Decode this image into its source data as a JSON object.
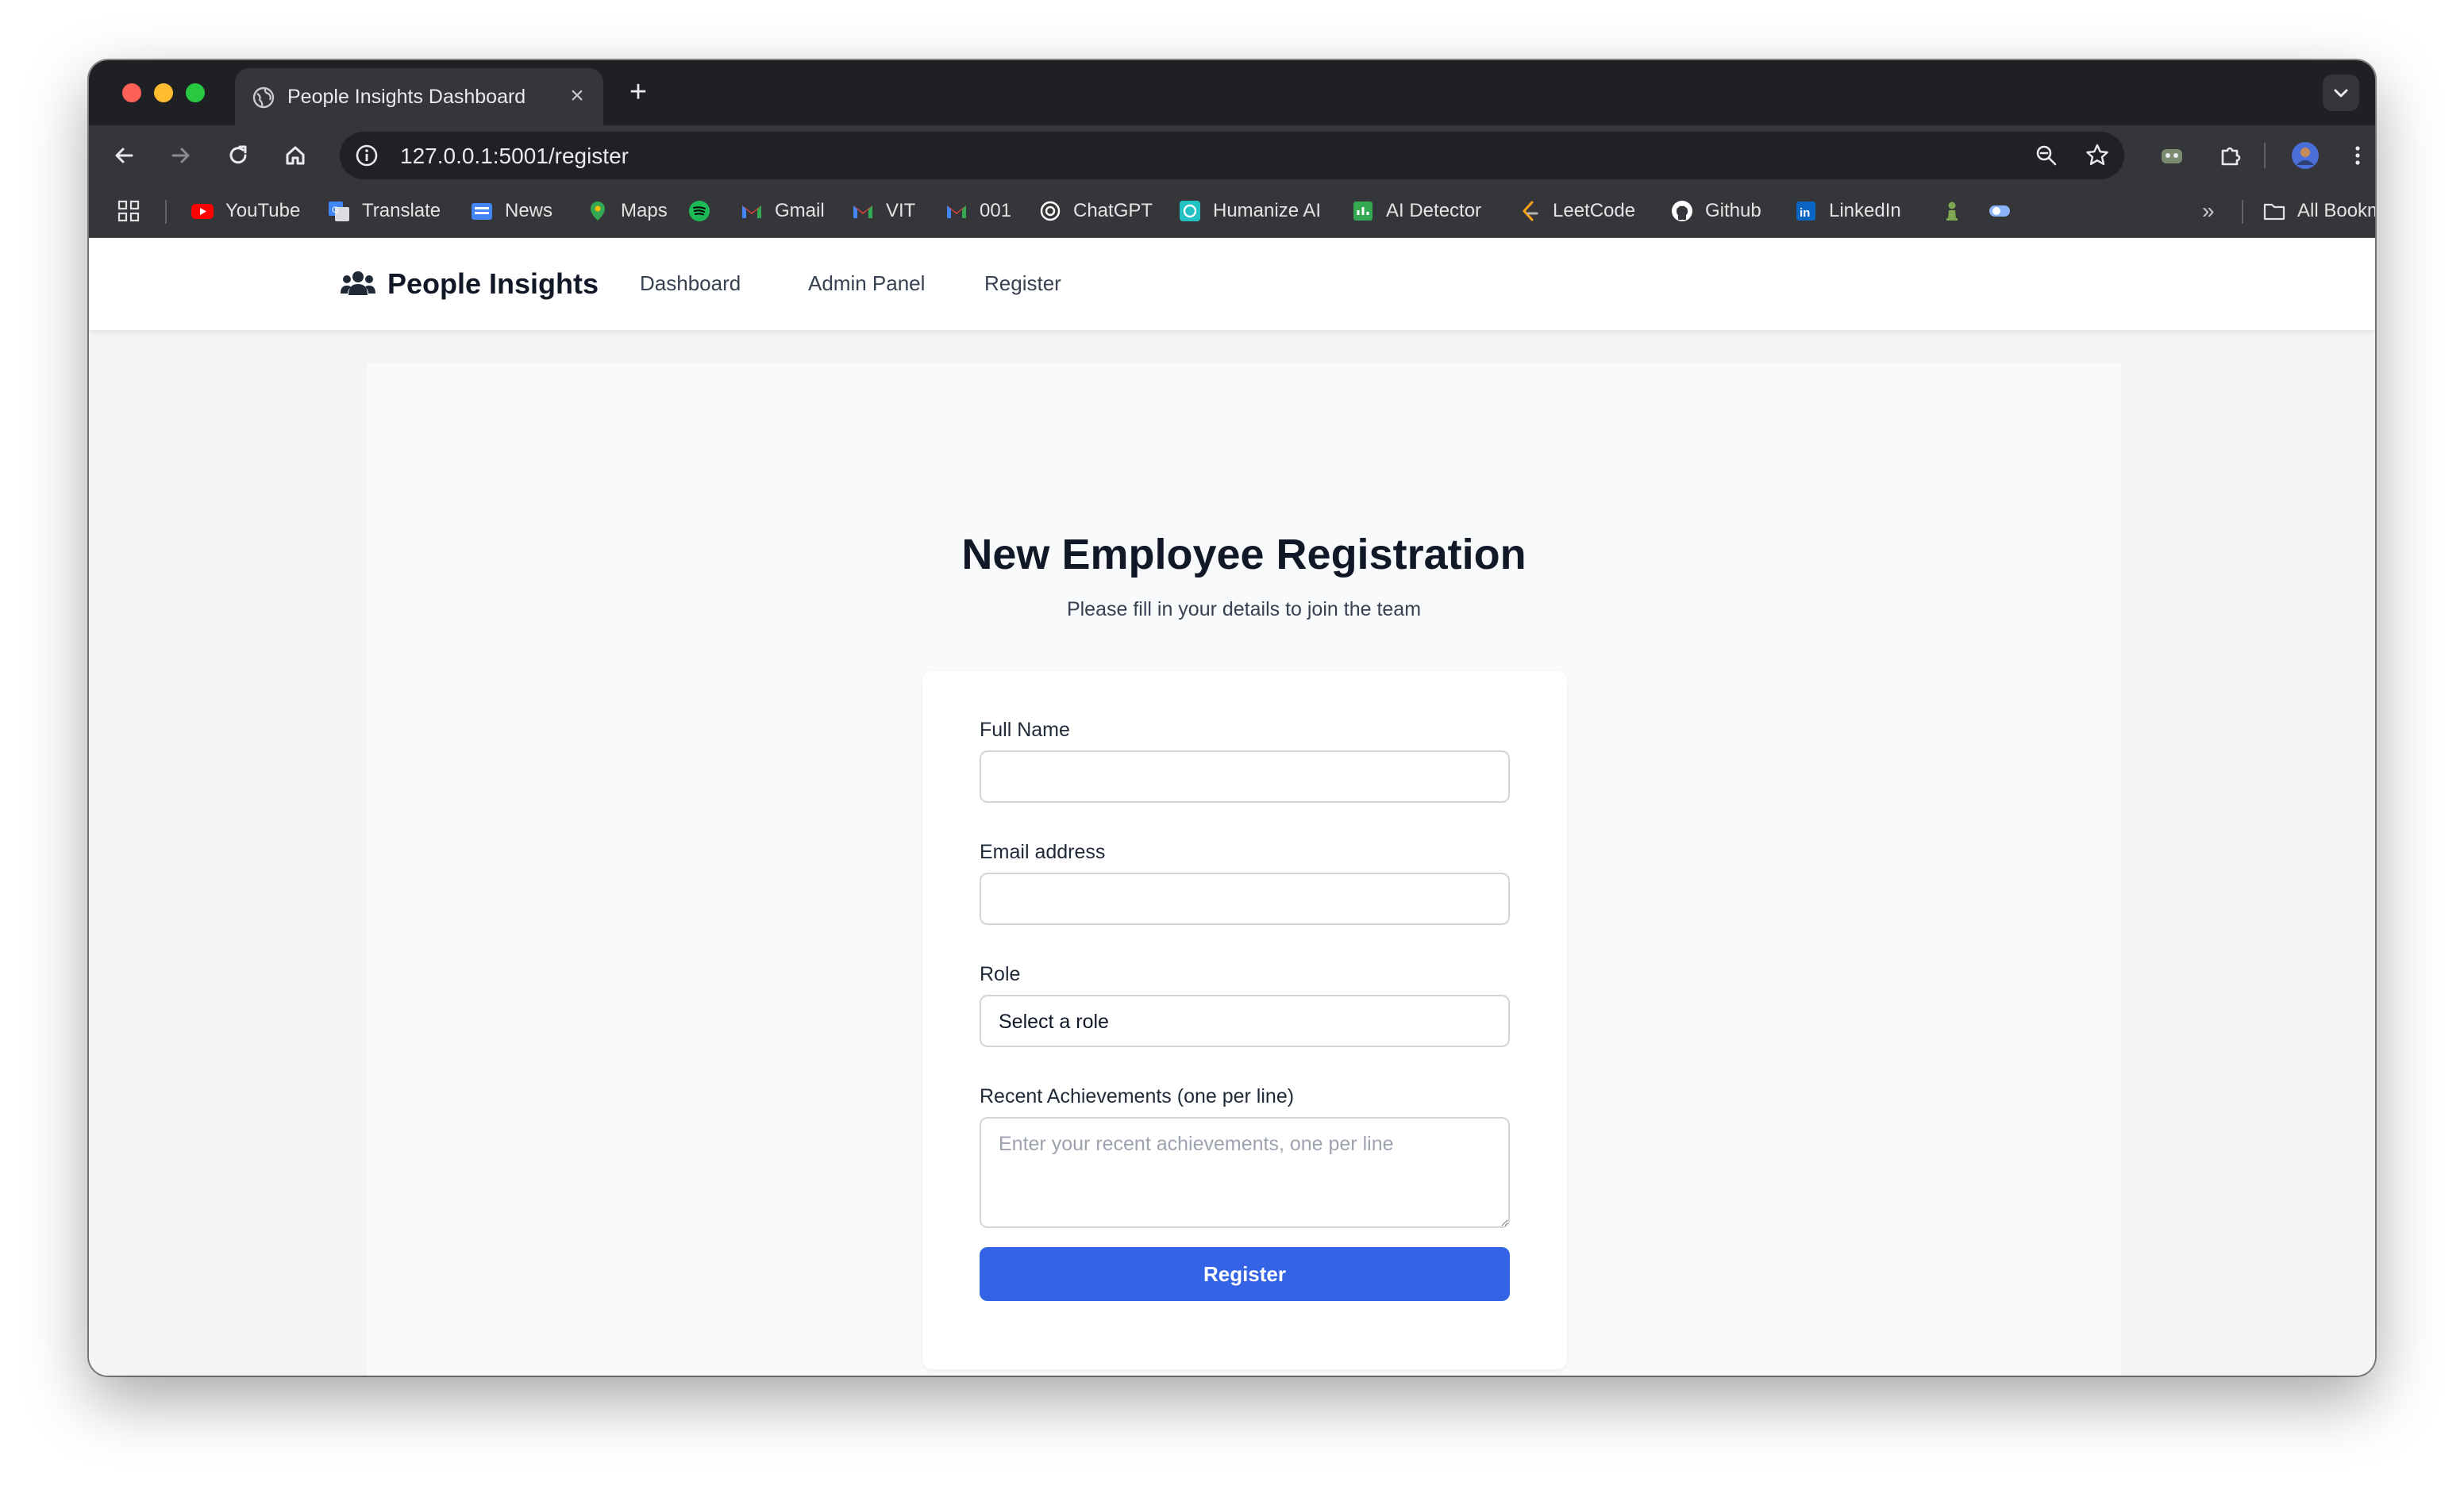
{
  "browser": {
    "tab_title": "People Insights Dashboard",
    "new_tab_label": "+",
    "close_label": "×",
    "url": "127.0.0.1:5001/register",
    "bookmarks": [
      {
        "label": "YouTube",
        "icon": "youtube-icon",
        "color": "#ff0000"
      },
      {
        "label": "Translate",
        "icon": "translate-icon",
        "color": "#4285f4"
      },
      {
        "label": "News",
        "icon": "news-icon",
        "color": "#4285f4"
      },
      {
        "label": "Maps",
        "icon": "maps-icon",
        "color": "#34a853"
      },
      {
        "label": "",
        "icon": "spotify-icon",
        "color": "#1db954"
      },
      {
        "label": "Gmail",
        "icon": "gmail-icon",
        "color": "#ea4335"
      },
      {
        "label": "VIT",
        "icon": "gmail-icon",
        "color": "#ea4335"
      },
      {
        "label": "001",
        "icon": "gmail-icon",
        "color": "#ea4335"
      },
      {
        "label": "ChatGPT",
        "icon": "chatgpt-icon",
        "color": "#ffffff"
      },
      {
        "label": "Humanize AI",
        "icon": "humanize-icon",
        "color": "#22c1c3"
      },
      {
        "label": "AI Detector",
        "icon": "detector-icon",
        "color": "#34a853"
      },
      {
        "label": "LeetCode",
        "icon": "leetcode-icon",
        "color": "#ffa116"
      },
      {
        "label": "Github",
        "icon": "github-icon",
        "color": "#ffffff"
      },
      {
        "label": "LinkedIn",
        "icon": "linkedin-icon",
        "color": "#0a66c2"
      }
    ],
    "all_bookmarks_label": "All Bookmarks",
    "more_bookmarks_label": "»"
  },
  "app": {
    "brand": "People Insights",
    "nav": [
      {
        "label": "Dashboard"
      },
      {
        "label": "Admin Panel"
      },
      {
        "label": "Register"
      }
    ],
    "accent_color": "#3563e5"
  },
  "form": {
    "title": "New Employee Registration",
    "subtitle": "Please fill in your details to join the team",
    "full_name_label": "Full Name",
    "full_name_value": "",
    "email_label": "Email address",
    "email_value": "",
    "role_label": "Role",
    "role_selected": "Select a role",
    "achievements_label": "Recent Achievements (one per line)",
    "achievements_placeholder": "Enter your recent achievements, one per line",
    "submit_label": "Register"
  }
}
